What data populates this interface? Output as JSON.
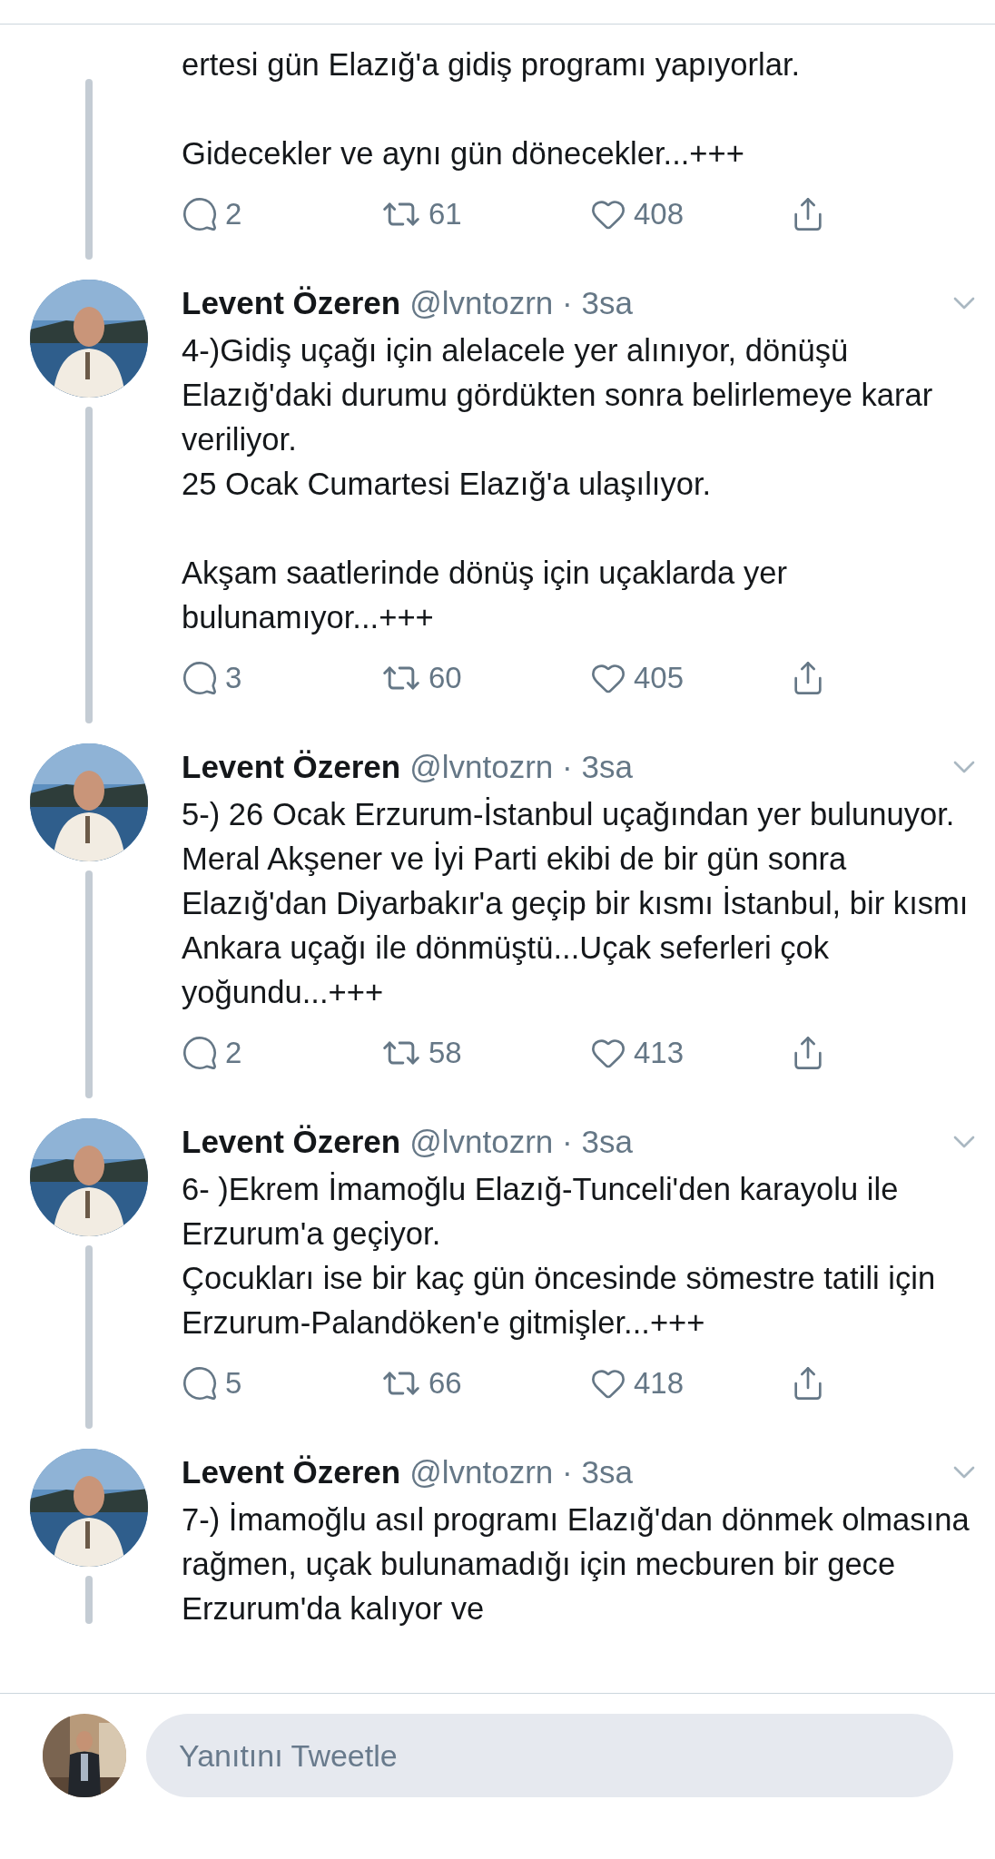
{
  "tweets": [
    {
      "kind": "continued",
      "text": "ertesi gün Elazığ'a gidiş programı yapıyorlar.\n\nGidecekler ve aynı gün dönecekler...+++",
      "replies": "2",
      "retweets": "61",
      "likes": "408"
    },
    {
      "kind": "full",
      "name": "Levent Özeren",
      "handle": "@lvntozrn",
      "separator": "·",
      "time": "3sa",
      "text": "4-)Gidiş uçağı için alelacele yer alınıyor, dönüşü Elazığ'daki durumu gördükten sonra belirlemeye karar veriliyor.\n25 Ocak Cumartesi Elazığ'a ulaşılıyor.\n\nAkşam saatlerinde dönüş için uçaklarda yer bulunamıyor...+++",
      "replies": "3",
      "retweets": "60",
      "likes": "405"
    },
    {
      "kind": "full",
      "name": "Levent Özeren",
      "handle": "@lvntozrn",
      "separator": "·",
      "time": "3sa",
      "text": "5-) 26 Ocak Erzurum-İstanbul uçağından yer bulunuyor.\nMeral Akşener ve İyi Parti ekibi de bir gün sonra Elazığ'dan Diyarbakır'a geçip bir kısmı İstanbul, bir kısmı Ankara uçağı ile dönmüştü...Uçak seferleri çok yoğundu...+++",
      "replies": "2",
      "retweets": "58",
      "likes": "413"
    },
    {
      "kind": "full",
      "name": "Levent Özeren",
      "handle": "@lvntozrn",
      "separator": "·",
      "time": "3sa",
      "text": "6- )Ekrem İmamoğlu Elazığ-Tunceli'den karayolu ile Erzurum'a geçiyor.\nÇocukları ise bir kaç gün öncesinde sömestre tatili için Erzurum-Palandöken'e gitmişler...+++",
      "replies": "5",
      "retweets": "66",
      "likes": "418"
    },
    {
      "kind": "full",
      "name": "Levent Özeren",
      "handle": "@lvntozrn",
      "separator": "·",
      "time": "3sa",
      "text": "7-) İmamoğlu asıl programı Elazığ'dan dönmek olmasına rağmen, uçak bulunamadığı için mecburen bir gece Erzurum'da kalıyor ve"
    }
  ],
  "reply": {
    "placeholder": "Yanıtını Tweetle"
  }
}
